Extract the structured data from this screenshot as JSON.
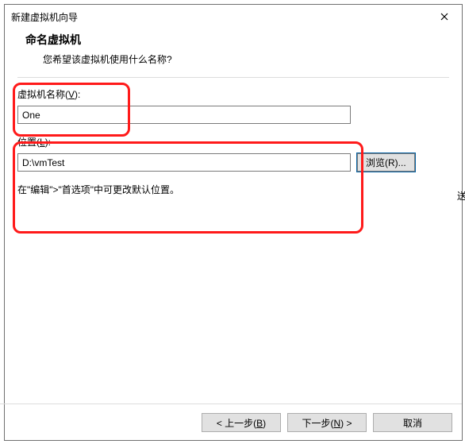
{
  "window": {
    "title": "新建虚拟机向导"
  },
  "header": {
    "heading": "命名虚拟机",
    "subtitle": "您希望该虚拟机使用什么名称?"
  },
  "nameField": {
    "labelPrefix": "虚拟机名称(",
    "hotkey": "V",
    "labelSuffix": "):",
    "value": "One"
  },
  "locField": {
    "labelPrefix": "位置(",
    "hotkey": "L",
    "labelSuffix": "):",
    "value": "D:\\vmTest"
  },
  "browse": {
    "prefix": "浏览(",
    "hotkey": "R",
    "suffix": ")..."
  },
  "hint": "在\"编辑\">\"首选项\"中可更改默认位置。",
  "buttons": {
    "back": {
      "prefix": "< 上一步(",
      "hotkey": "B",
      "suffix": ")"
    },
    "next": {
      "prefix": "下一步(",
      "hotkey": "N",
      "suffix": ") >"
    },
    "cancel": "取消"
  },
  "external": {
    "char": "送"
  }
}
